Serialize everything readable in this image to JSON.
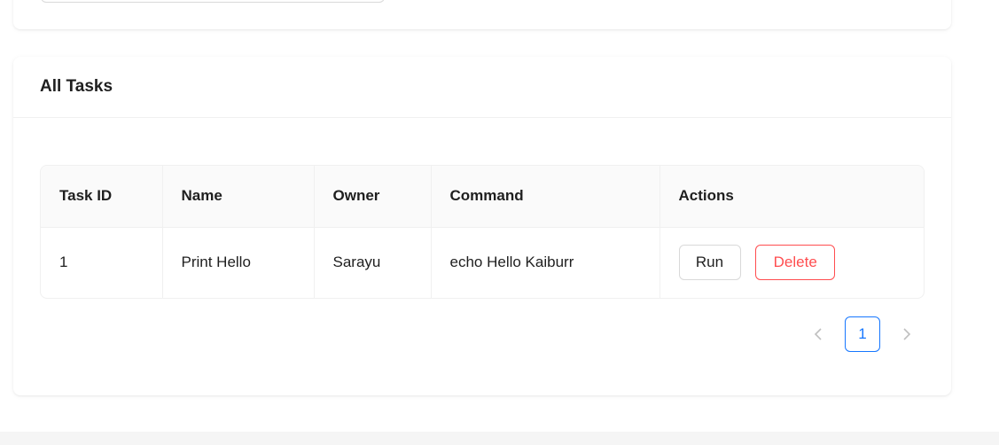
{
  "tasks_card": {
    "title": "All Tasks"
  },
  "table": {
    "columns": [
      "Task ID",
      "Name",
      "Owner",
      "Command",
      "Actions"
    ],
    "rows": [
      {
        "id": "1",
        "name": "Print Hello",
        "owner": "Sarayu",
        "command": "echo Hello Kaiburr"
      }
    ],
    "actions": {
      "run_label": "Run",
      "delete_label": "Delete"
    }
  },
  "pagination": {
    "prev_icon": "chevron-left-icon",
    "next_icon": "chevron-right-icon",
    "current_page": "1"
  },
  "colors": {
    "primary": "#1677ff",
    "danger": "#ff4d4f",
    "header_bg": "#fafafa",
    "border": "#f0f0f0"
  }
}
